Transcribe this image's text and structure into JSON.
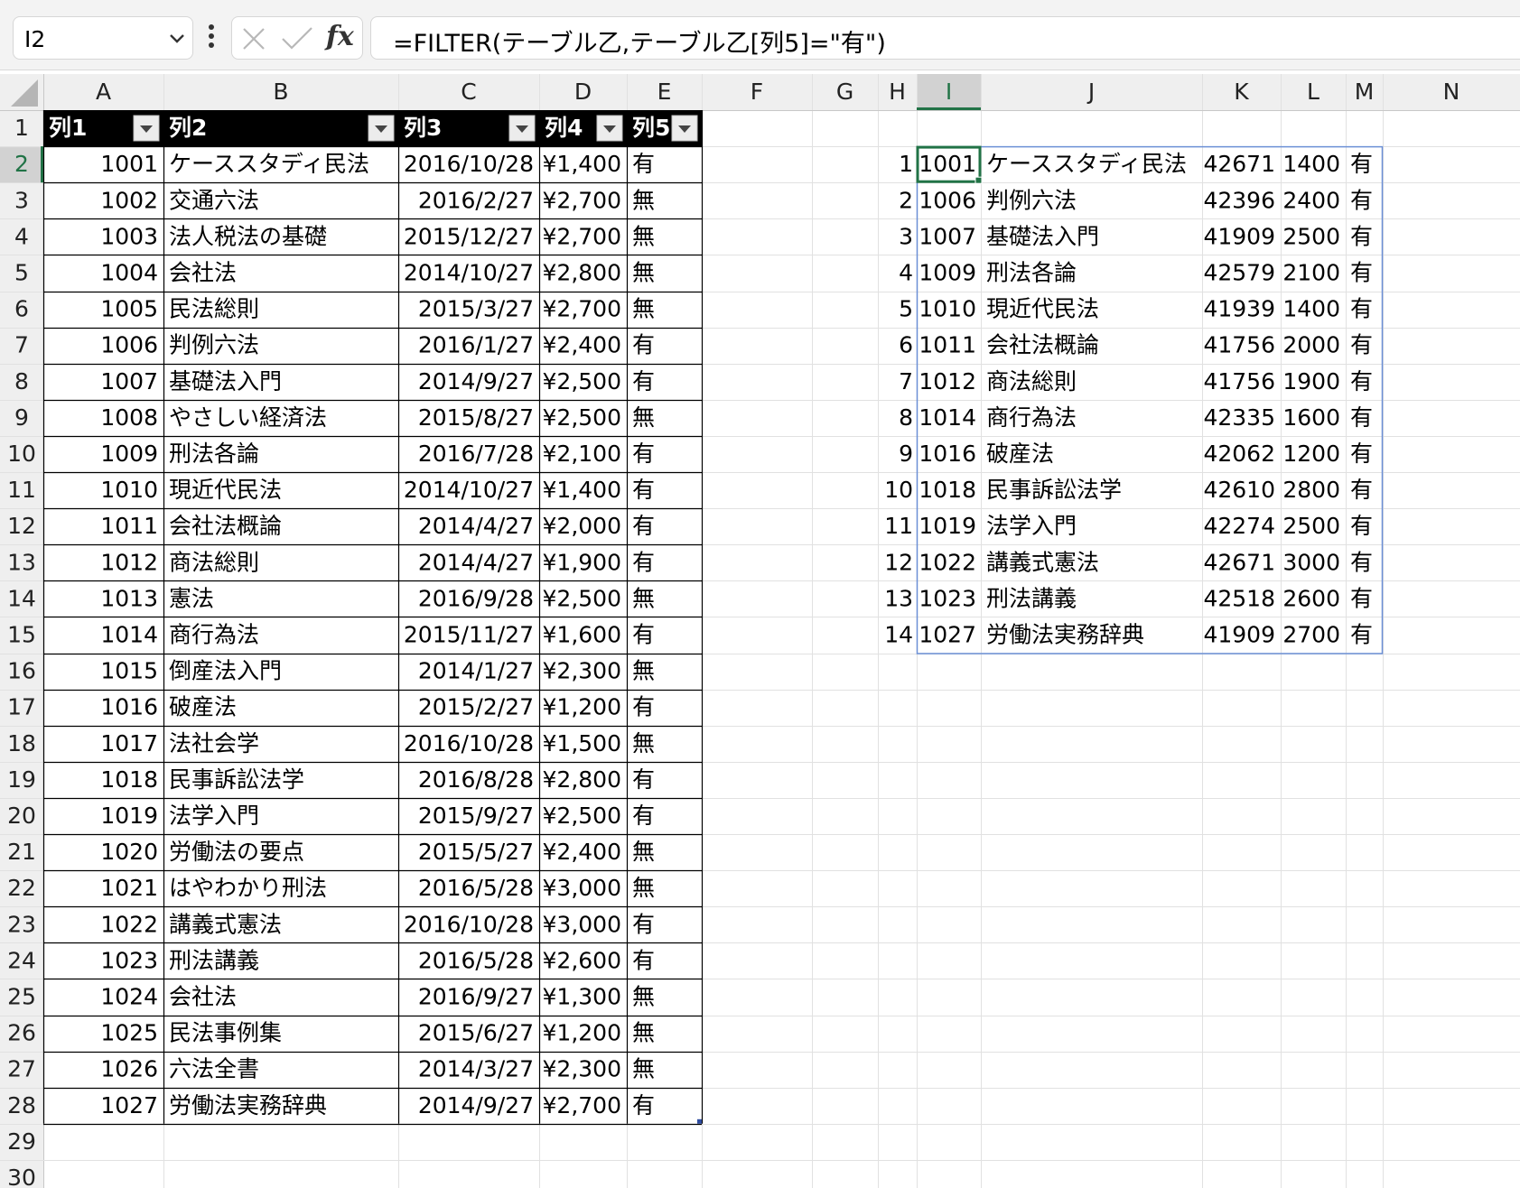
{
  "formula_bar": {
    "name_box": "I2",
    "cancel_icon": "cancel-icon",
    "enter_icon": "checkmark-icon",
    "fx_label": "fx",
    "formula": "=FILTER(テーブル乙,テーブル乙[列5]=\"有\")"
  },
  "columns": [
    "A",
    "B",
    "C",
    "D",
    "E",
    "F",
    "G",
    "H",
    "I",
    "J",
    "K",
    "L",
    "M",
    "N"
  ],
  "selected_cell": "I2",
  "table": {
    "headers": [
      "列1",
      "列2",
      "列3",
      "列4",
      "列5"
    ],
    "rows": [
      [
        "1001",
        "ケーススタディ民法",
        "2016/10/28",
        "¥1,400",
        "有"
      ],
      [
        "1002",
        "交通六法",
        "2016/2/27",
        "¥2,700",
        "無"
      ],
      [
        "1003",
        "法人税法の基礎",
        "2015/12/27",
        "¥2,700",
        "無"
      ],
      [
        "1004",
        "会社法",
        "2014/10/27",
        "¥2,800",
        "無"
      ],
      [
        "1005",
        "民法総則",
        "2015/3/27",
        "¥2,700",
        "無"
      ],
      [
        "1006",
        "判例六法",
        "2016/1/27",
        "¥2,400",
        "有"
      ],
      [
        "1007",
        "基礎法入門",
        "2014/9/27",
        "¥2,500",
        "有"
      ],
      [
        "1008",
        "やさしい経済法",
        "2015/8/27",
        "¥2,500",
        "無"
      ],
      [
        "1009",
        "刑法各論",
        "2016/7/28",
        "¥2,100",
        "有"
      ],
      [
        "1010",
        "現近代民法",
        "2014/10/27",
        "¥1,400",
        "有"
      ],
      [
        "1011",
        "会社法概論",
        "2014/4/27",
        "¥2,000",
        "有"
      ],
      [
        "1012",
        "商法総則",
        "2014/4/27",
        "¥1,900",
        "有"
      ],
      [
        "1013",
        "憲法",
        "2016/9/28",
        "¥2,500",
        "無"
      ],
      [
        "1014",
        "商行為法",
        "2015/11/27",
        "¥1,600",
        "有"
      ],
      [
        "1015",
        "倒産法入門",
        "2014/1/27",
        "¥2,300",
        "無"
      ],
      [
        "1016",
        "破産法",
        "2015/2/27",
        "¥1,200",
        "有"
      ],
      [
        "1017",
        "法社会学",
        "2016/10/28",
        "¥1,500",
        "無"
      ],
      [
        "1018",
        "民事訴訟法学",
        "2016/8/28",
        "¥2,800",
        "有"
      ],
      [
        "1019",
        "法学入門",
        "2015/9/27",
        "¥2,500",
        "有"
      ],
      [
        "1020",
        "労働法の要点",
        "2015/5/27",
        "¥2,400",
        "無"
      ],
      [
        "1021",
        "はやわかり刑法",
        "2016/5/28",
        "¥3,000",
        "無"
      ],
      [
        "1022",
        "講義式憲法",
        "2016/10/28",
        "¥3,000",
        "有"
      ],
      [
        "1023",
        "刑法講義",
        "2016/5/28",
        "¥2,600",
        "有"
      ],
      [
        "1024",
        "会社法",
        "2016/9/27",
        "¥1,300",
        "無"
      ],
      [
        "1025",
        "民法事例集",
        "2015/6/27",
        "¥1,200",
        "無"
      ],
      [
        "1026",
        "六法全書",
        "2014/3/27",
        "¥2,300",
        "無"
      ],
      [
        "1027",
        "労働法実務辞典",
        "2014/9/27",
        "¥2,700",
        "有"
      ]
    ]
  },
  "filter_result": {
    "rows": [
      [
        "1",
        "1001",
        "ケーススタディ民法",
        "42671",
        "1400",
        "有"
      ],
      [
        "2",
        "1006",
        "判例六法",
        "42396",
        "2400",
        "有"
      ],
      [
        "3",
        "1007",
        "基礎法入門",
        "41909",
        "2500",
        "有"
      ],
      [
        "4",
        "1009",
        "刑法各論",
        "42579",
        "2100",
        "有"
      ],
      [
        "5",
        "1010",
        "現近代民法",
        "41939",
        "1400",
        "有"
      ],
      [
        "6",
        "1011",
        "会社法概論",
        "41756",
        "2000",
        "有"
      ],
      [
        "7",
        "1012",
        "商法総則",
        "41756",
        "1900",
        "有"
      ],
      [
        "8",
        "1014",
        "商行為法",
        "42335",
        "1600",
        "有"
      ],
      [
        "9",
        "1016",
        "破産法",
        "42062",
        "1200",
        "有"
      ],
      [
        "10",
        "1018",
        "民事訴訟法学",
        "42610",
        "2800",
        "有"
      ],
      [
        "11",
        "1019",
        "法学入門",
        "42274",
        "2500",
        "有"
      ],
      [
        "12",
        "1022",
        "講義式憲法",
        "42671",
        "3000",
        "有"
      ],
      [
        "13",
        "1023",
        "刑法講義",
        "42518",
        "2600",
        "有"
      ],
      [
        "14",
        "1027",
        "労働法実務辞典",
        "41909",
        "2700",
        "有"
      ]
    ]
  },
  "colors": {
    "header_bg": "#efefef",
    "gridline": "#e1e1e1",
    "table_header_bg": "#000000",
    "selection": "#217346",
    "spill_border": "#6b8fd6"
  }
}
